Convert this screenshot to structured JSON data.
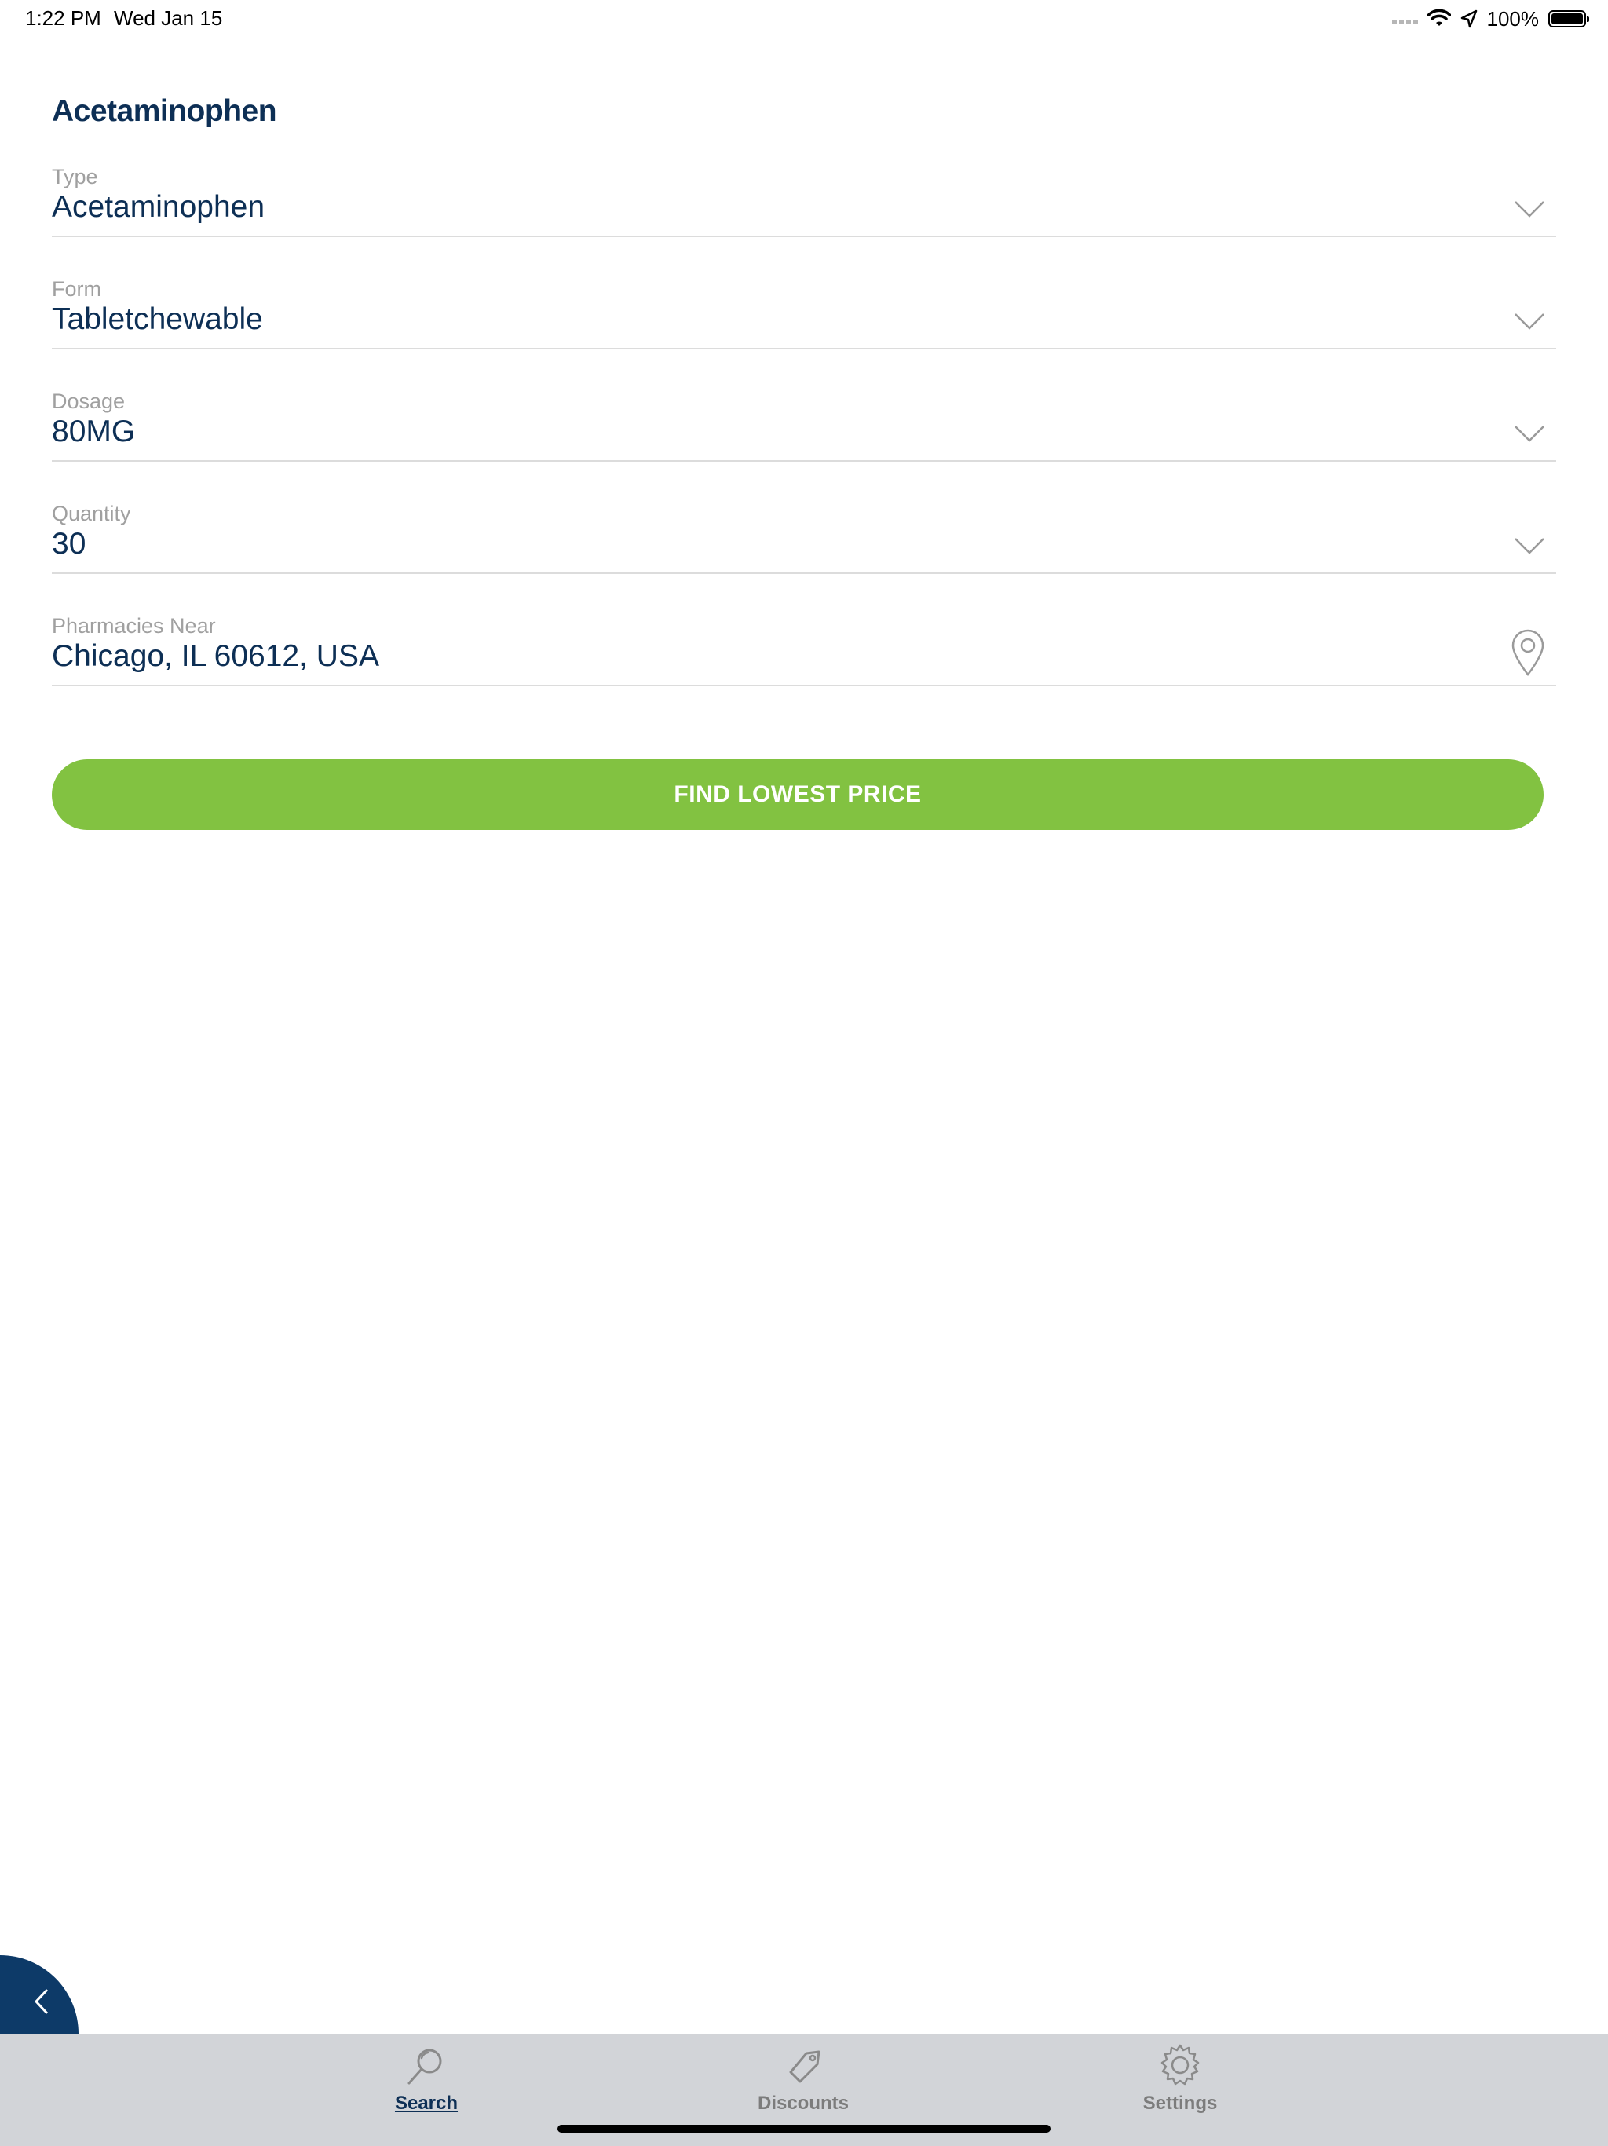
{
  "status_bar": {
    "time": "1:22 PM",
    "date": "Wed Jan 15",
    "battery": "100%"
  },
  "page": {
    "title": "Acetaminophen"
  },
  "fields": {
    "type": {
      "label": "Type",
      "value": "Acetaminophen"
    },
    "form": {
      "label": "Form",
      "value": "Tabletchewable"
    },
    "dosage": {
      "label": "Dosage",
      "value": "80MG"
    },
    "quantity": {
      "label": "Quantity",
      "value": "30"
    },
    "pharmacies_near": {
      "label": "Pharmacies Near",
      "value": "Chicago, IL 60612, USA"
    }
  },
  "actions": {
    "find_label": "FIND LOWEST PRICE"
  },
  "tab_bar": {
    "tabs": [
      {
        "label": "Search",
        "icon": "search-icon",
        "active": true
      },
      {
        "label": "Discounts",
        "icon": "tag-icon",
        "active": false
      },
      {
        "label": "Settings",
        "icon": "gear-icon",
        "active": false
      }
    ]
  },
  "colors": {
    "primary_text": "#0d2f55",
    "accent_green": "#82c241",
    "label_gray": "#a0a0a0",
    "tab_bar_bg": "#d2d4d8",
    "fab_blue": "#0d3a68"
  }
}
